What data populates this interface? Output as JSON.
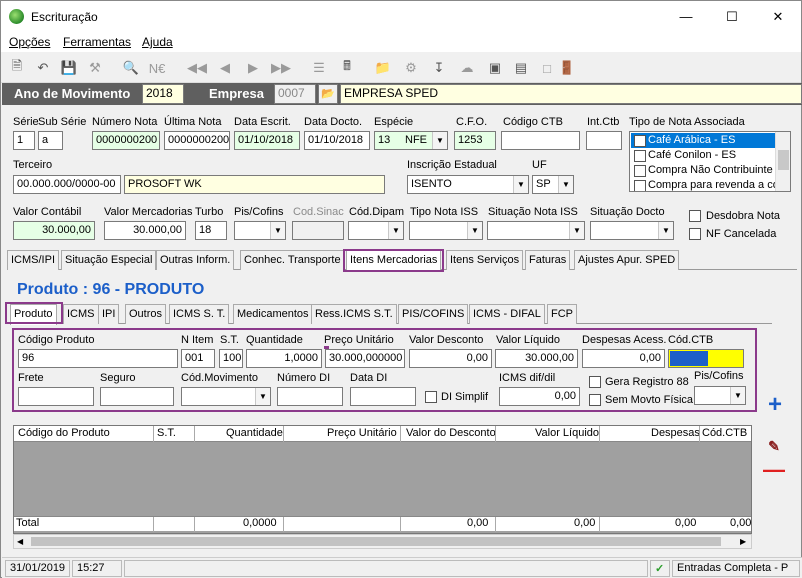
{
  "window": {
    "title": "Escrituração"
  },
  "menu": [
    "Opções",
    "Ferramentas",
    "Ajuda"
  ],
  "header": {
    "ano_label": "Ano de Movimento",
    "ano_value": "2018",
    "empresa_label": "Empresa",
    "empresa_code": "0007",
    "empresa_name": "EMPRESA SPED"
  },
  "doc": {
    "serie_label": "Série",
    "serie": "1",
    "subserie_label": "Sub Série",
    "subserie": "a",
    "numero_label": "Número Nota",
    "numero": "0000000200",
    "ultima_label": "Última Nota",
    "ultima": "0000000200",
    "data_escrit_label": "Data Escrit.",
    "data_escrit": "01/10/2018",
    "data_docto_label": "Data Docto.",
    "data_docto": "01/10/2018",
    "especie_label": "Espécie",
    "especie_code": "13",
    "especie": "NFE",
    "cfo_label": "C.F.O.",
    "cfo": "1253",
    "codigo_ctb_label": "Código CTB",
    "codigo_ctb": "",
    "int_ctb_label": "Int.Ctb",
    "int_ctb": "",
    "tipo_nota_label": "Tipo de Nota Associada",
    "tipo_nota_items": [
      "Café Arábica - ES",
      "Café Conilon - ES",
      "Compra Não Contribuinte",
      "Compra para revenda a co"
    ],
    "terceiro_label": "Terceiro",
    "terceiro_cnpj": "00.000.000/0000-00",
    "terceiro_nome": "PROSOFT WK",
    "ie_label": "Inscrição Estadual",
    "ie": "ISENTO",
    "uf_label": "UF",
    "uf": "SP",
    "valor_contabil_label": "Valor Contábil",
    "valor_contabil": "30.000,00",
    "valor_merc_label": "Valor Mercadorias",
    "valor_merc": "30.000,00",
    "turbo_label": "Turbo",
    "turbo": "18",
    "pis_cofins_label": "Pis/Cofins",
    "cod_sinac_label": "Cod.Sinac",
    "cod_dipam_label": "Cód.Dipam",
    "tipo_iss_label": "Tipo Nota ISS",
    "sit_iss_label": "Situação Nota ISS",
    "sit_docto_label": "Situação Docto",
    "desdobra_label": "Desdobra Nota",
    "nf_cancelada_label": "NF Cancelada"
  },
  "tabs_main": [
    "ICMS/IPI",
    "Situação Especial",
    "Outras Inform.",
    "Conhec. Transporte",
    "Itens Mercadorias",
    "Itens Serviços",
    "Faturas",
    "Ajustes Apur. SPED"
  ],
  "produto_title": "Produto : 96 - PRODUTO",
  "tabs_sub": [
    "Produto",
    "ICMS",
    "IPI",
    "Outros",
    "ICMS S. T.",
    "Medicamentos",
    "Ress.ICMS S.T.",
    "PIS/COFINS",
    "ICMS - DIFAL",
    "FCP"
  ],
  "item": {
    "cod_produto_label": "Código Produto",
    "cod_produto": "96",
    "n_item_label": "N Item",
    "n_item": "001",
    "st_label": "S.T.",
    "st": "100",
    "quantidade_label": "Quantidade",
    "quantidade": "1,0000",
    "preco_label": "Preço Unitário",
    "preco": "30.000,000000",
    "desconto_label": "Valor Desconto",
    "desconto": "0,00",
    "liquido_label": "Valor Líquido",
    "liquido": "30.000,00",
    "despesas_label": "Despesas Acess.",
    "despesas": "0,00",
    "cod_ctb_label": "Cód.CTB",
    "frete_label": "Frete",
    "seguro_label": "Seguro",
    "cod_mov_label": "Cód.Movimento",
    "numero_di_label": "Número DI",
    "data_di_label": "Data DI",
    "di_simplif_label": "DI Simplif",
    "icms_dif_label": "ICMS dif/dil",
    "icms_dif": "0,00",
    "gera_registro_label": "Gera Registro 88",
    "sem_movto_label": "Sem Movto Física",
    "pis_cofins_label": "Pis/Cofins"
  },
  "grid": {
    "headers": [
      "Código do Produto",
      "S.T.",
      "Quantidade",
      "Preço Unitário",
      "Valor do Desconto",
      "Valor Líquido",
      "Despesas",
      "Cód.CTB"
    ],
    "total_label": "Total",
    "totals": [
      "0,0000",
      "0,00",
      "0,00",
      "0,00",
      "0,00"
    ]
  },
  "status": {
    "date": "31/01/2019",
    "time": "15:27",
    "mode": "Entradas Completa - P"
  },
  "colors": {
    "accent": "#1c5fc9",
    "highlight": "#8b3a8b",
    "header_bar": "#5f5f5f"
  }
}
